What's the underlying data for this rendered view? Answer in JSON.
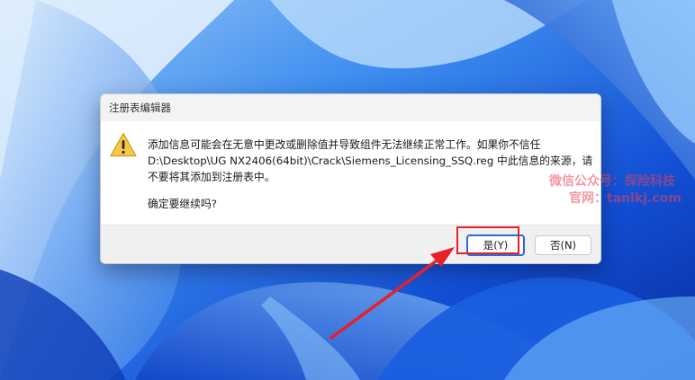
{
  "dialog": {
    "title": "注册表编辑器",
    "message_line1": "添加信息可能会在无意中更改或删除值并导致组件无法继续正常工作。如果你不信任",
    "message_line2": "D:\\Desktop\\UG NX2406(64bit)\\Crack\\Siemens_Licensing_SSQ.reg 中此信息的来源，请",
    "message_line3": "不要将其添加到注册表中。",
    "question": "确定要继续吗?",
    "yes_label": "是(Y)",
    "no_label": "否(N)",
    "icon": "warning-icon"
  },
  "watermark": {
    "line1": "微信公众号：探险科技",
    "line2": "官网：tanlkj.com"
  },
  "colors": {
    "annotation": "#e8202a",
    "accent": "#2a6bd8",
    "warning": "#f7c948"
  }
}
